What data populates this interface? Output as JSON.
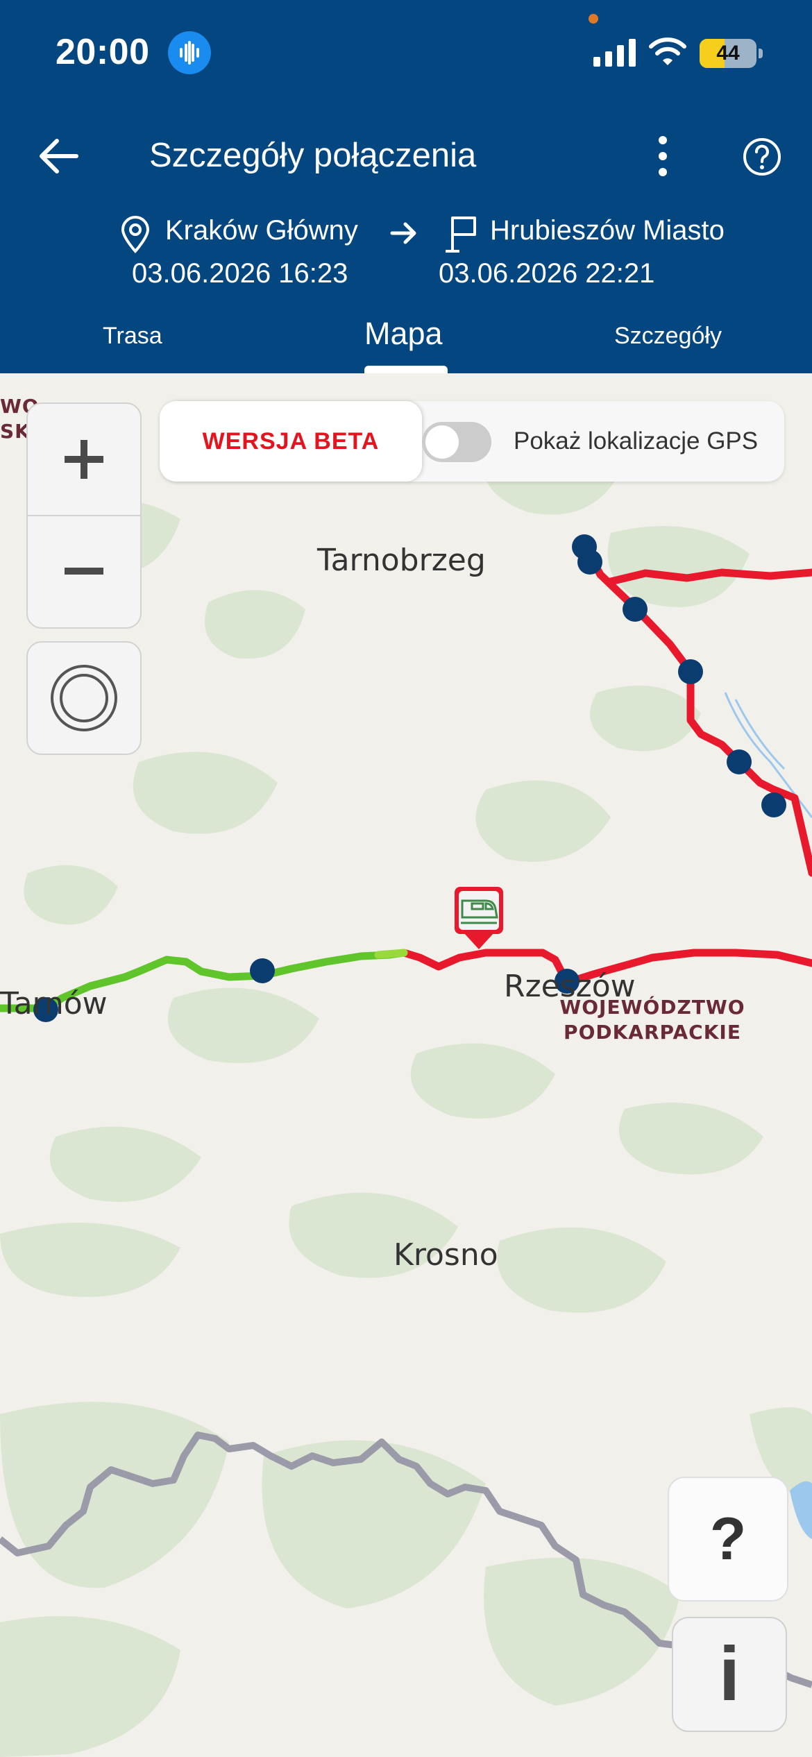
{
  "status_bar": {
    "time": "20:00",
    "battery": "44",
    "battery_level": 0.44
  },
  "header": {
    "title": "Szczegóły połączenia",
    "origin": {
      "name": "Kraków Główny",
      "datetime": "03.06.2026 16:23"
    },
    "destination": {
      "name": "Hrubieszów Miasto",
      "datetime": "03.06.2026 22:21"
    }
  },
  "tabs": [
    {
      "label": "Trasa",
      "active": false
    },
    {
      "label": "Mapa",
      "active": true
    },
    {
      "label": "Szczegóły",
      "active": false
    }
  ],
  "map": {
    "beta_label": "WERSJA BETA",
    "gps_toggle_label": "Pokaż lokalizacje GPS",
    "gps_enabled": false,
    "cities": [
      "Tarnobrzeg",
      "Tarnów",
      "Rzeszów",
      "Krosno"
    ],
    "region_label": [
      "WOJEWÓDZTWO",
      "PODKARPACKIE"
    ],
    "edge_region_label": [
      "WO",
      "SKIE"
    ],
    "help_button": "?",
    "info_button": "i",
    "colors": {
      "traveled": "#5fc52a",
      "remaining": "#e8192c",
      "station": "#0b3c70",
      "border": "#9b9aa8",
      "water": "#9cc8ee"
    }
  }
}
